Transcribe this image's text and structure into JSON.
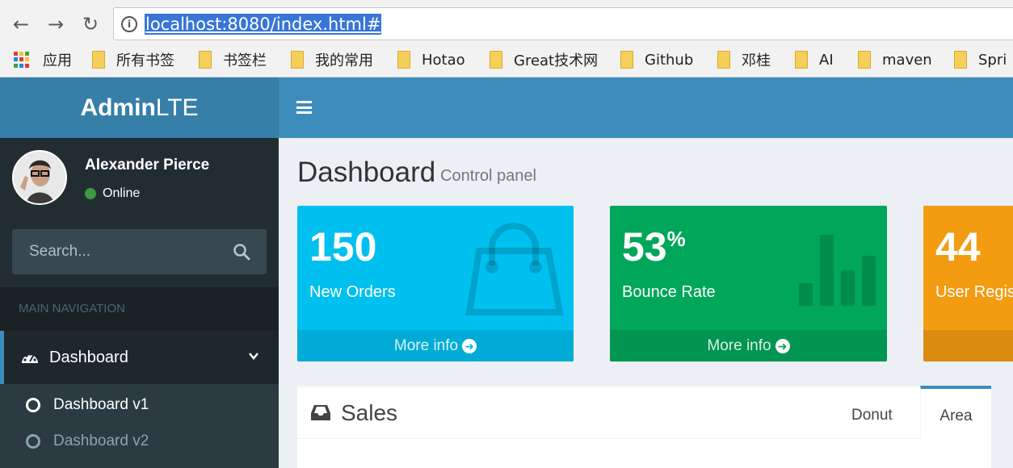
{
  "browser": {
    "url": "localhost:8080/index.html#",
    "bookmarks": [
      "应用",
      "所有书签",
      "书签栏",
      "我的常用",
      "Hotao",
      "Great技术网",
      "Github",
      "邓桂",
      "AI",
      "maven",
      "Spri"
    ]
  },
  "header": {
    "logo_bold": "Admin",
    "logo_light": "LTE"
  },
  "sidebar": {
    "user": {
      "name": "Alexander Pierce",
      "status": "Online"
    },
    "search_placeholder": "Search...",
    "nav_header": "MAIN NAVIGATION",
    "menu": {
      "label": "Dashboard",
      "sub_items": [
        "Dashboard v1",
        "Dashboard v2"
      ]
    }
  },
  "content": {
    "title": "Dashboard",
    "subtitle": "Control panel",
    "boxes": [
      {
        "value": "150",
        "suffix": "",
        "label": "New Orders",
        "footer": "More info",
        "color": "#00c0ef",
        "footer_color": "#00acd6"
      },
      {
        "value": "53",
        "suffix": "%",
        "label": "Bounce Rate",
        "footer": "More info",
        "color": "#00a65a",
        "footer_color": "#009551"
      },
      {
        "value": "44",
        "suffix": "",
        "label": "User Regis",
        "footer": "",
        "color": "#f39c12",
        "footer_color": "#da8c10"
      }
    ],
    "sales": {
      "title": "Sales",
      "tabs": [
        "Donut",
        "Area"
      ],
      "active_tab": "Area"
    }
  },
  "colors": {
    "header_logo": "#367fa9",
    "header_bar": "#3c8dbc",
    "sidebar": "#222d32",
    "content_bg": "#ecf0f5"
  }
}
